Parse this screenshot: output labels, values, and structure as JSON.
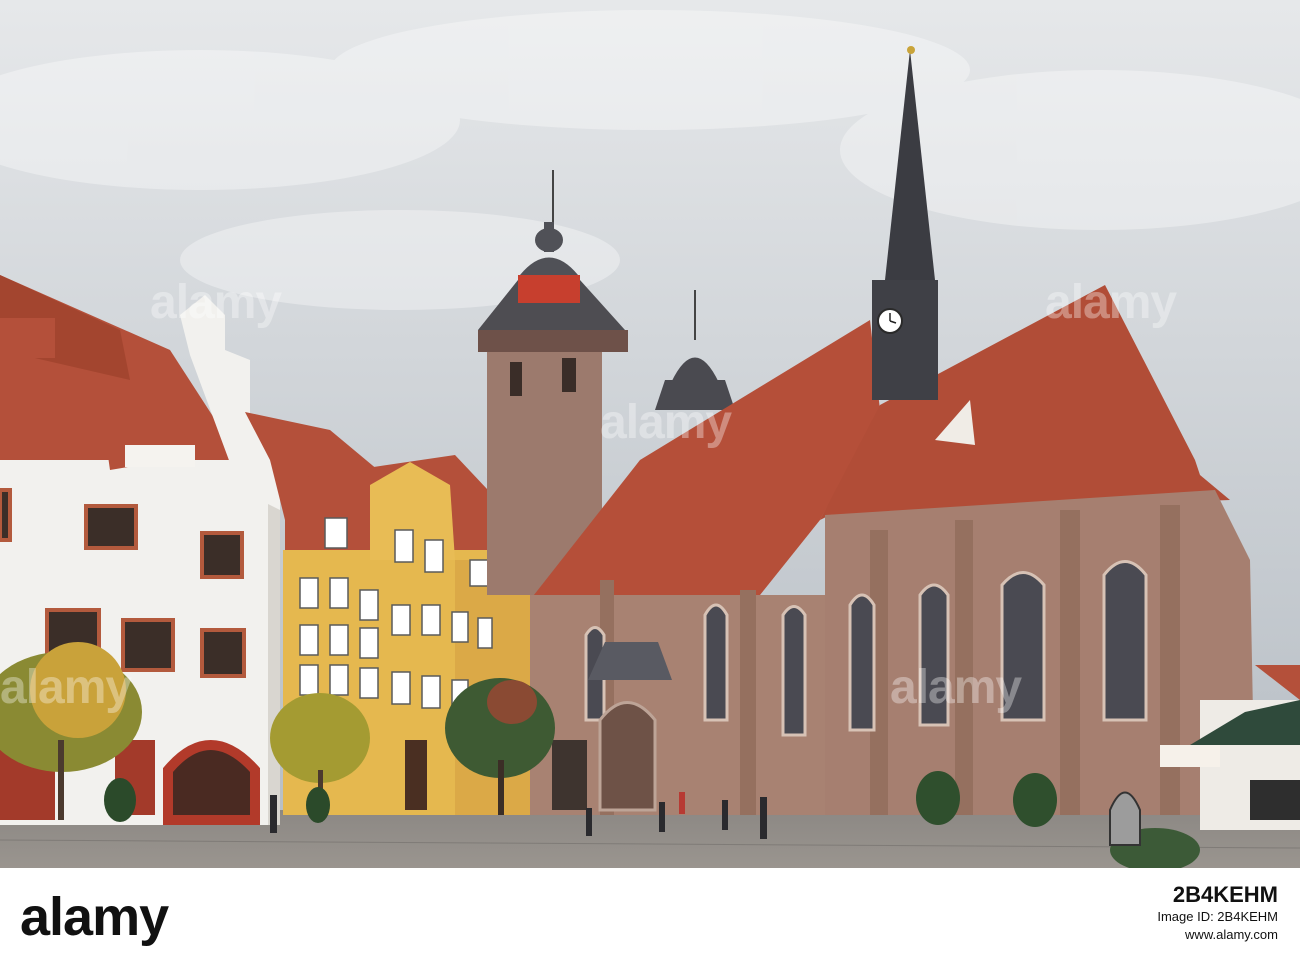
{
  "watermark": {
    "text": "alamy"
  },
  "footer": {
    "brand": "alamy",
    "image_id_line": "Image ID: 2B4KEHM",
    "site": "www.alamy.com",
    "ref_code": "2B4KEHM"
  },
  "scene": {
    "clock": "church-clock",
    "sky_color": "#c9ced3",
    "roof_color": "#b4503a",
    "stone_color": "#a67f70",
    "yellow_house_color": "#e5b84f",
    "white_house_color": "#f2f1ee",
    "pavement_color": "#8e8a86"
  }
}
